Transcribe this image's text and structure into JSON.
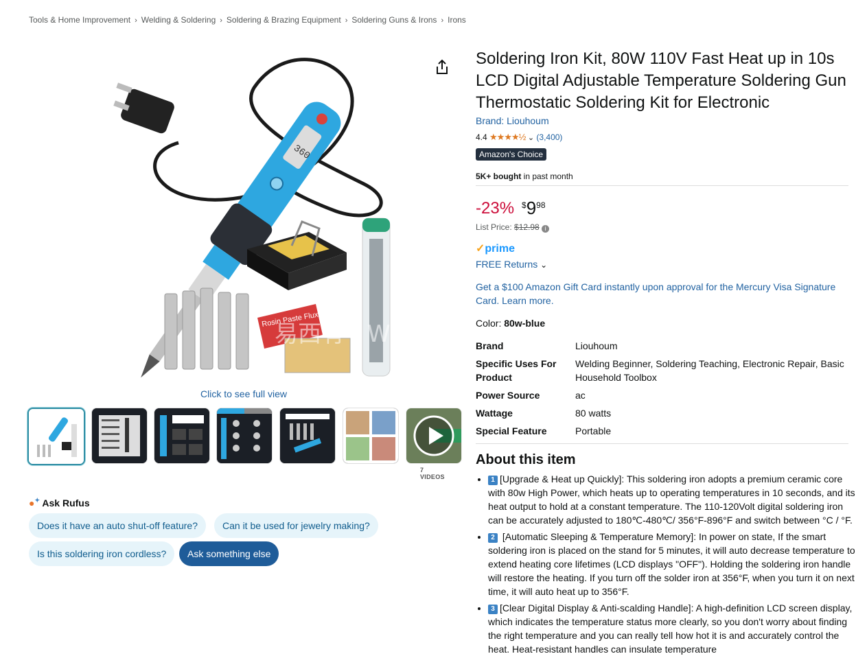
{
  "breadcrumb": [
    "Tools & Home Improvement",
    "Welding & Soldering",
    "Soldering & Brazing Equipment",
    "Soldering Guns & Irons",
    "Irons"
  ],
  "gallery": {
    "see_full_view": "Click to see full view",
    "video_count": "7 VIDEOS",
    "watermark": "易西有 | W"
  },
  "rufus": {
    "title": "Ask Rufus",
    "questions": [
      "Does it have an auto shut-off feature?",
      "Can it be used for jewelry making?",
      "Is this soldering iron cordless?"
    ],
    "ask_else": "Ask something else"
  },
  "product": {
    "title": "Soldering Iron Kit, 80W 110V Fast Heat up in 10s LCD Digital Adjustable Temperature Soldering Gun Thermostatic Soldering Kit for Electronic",
    "brand_link": "Brand: Liouhoum",
    "rating": "4.4",
    "stars": "★★★★½",
    "review_count": "(3,400)",
    "badge": "Amazon's Choice",
    "bought_bold": "5K+ bought",
    "bought_rest": " in past month",
    "discount": "-23%",
    "price_symbol": "$",
    "price_whole": "9",
    "price_fraction": "98",
    "list_price_label": "List Price: ",
    "list_price": "$12.98",
    "prime": "prime",
    "prime_check": "✓",
    "free_returns": "FREE Returns",
    "promo": "Get a $100 Amazon Gift Card instantly upon approval for the Mercury Visa Signature Card. Learn more.",
    "color_label": "Color: ",
    "color_value": "80w-blue"
  },
  "specs": [
    {
      "label": "Brand",
      "value": "Liouhoum"
    },
    {
      "label": "Specific Uses For Product",
      "value": "Welding Beginner, Soldering Teaching, Electronic Repair, Basic Household Toolbox"
    },
    {
      "label": "Power Source",
      "value": "ac"
    },
    {
      "label": "Wattage",
      "value": "80 watts"
    },
    {
      "label": "Special Feature",
      "value": "Portable"
    }
  ],
  "about": {
    "title": "About this item",
    "bullets": [
      {
        "num": "1",
        "text": "[Upgrade & Heat up Quickly]: This soldering iron adopts a premium ceramic core with 80w High Power, which heats up to operating temperatures in 10 seconds, and its heat output to hold at a constant temperature. The 110-120Volt digital soldering iron can be accurately adjusted to 180℃-480℃/ 356°F-896°F and switch between °C / °F."
      },
      {
        "num": "2",
        "text": " [Automatic Sleeping & Temperature Memory]: In power on state, If the smart soldering iron is placed on the stand for 5 minutes, it will auto decrease temperature to extend heating core lifetimes (LCD displays \"OFF\"). Holding the soldering iron handle will restore the heating. If you turn off the solder iron at 356°F, when you turn it on next time, it will auto heat up to 356°F."
      },
      {
        "num": "3",
        "text": "[Clear Digital Display & Anti-scalding Handle]: A high-definition LCD screen display, which indicates the temperature status more clearly, so you don't worry about finding the right temperature and you can really tell how hot it is and accurately control the heat. Heat-resistant handles can insulate temperature"
      }
    ]
  },
  "colors": {
    "link": "#2162a1",
    "discount": "#cc0c39",
    "badge_bg": "#232f3e",
    "chip_bg": "#e6f4fa",
    "chip_dark": "#1f5c99",
    "star": "#de7921",
    "prime": "#1a98ff"
  }
}
